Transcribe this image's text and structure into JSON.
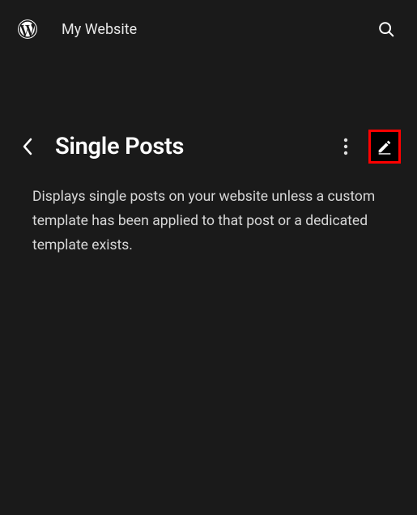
{
  "topbar": {
    "site_title": "My Website"
  },
  "header": {
    "page_title": "Single Posts"
  },
  "content": {
    "description": "Displays single posts on your website unless a custom template has been applied to that post or a dedicated template exists."
  },
  "highlight": {
    "color": "#ff0000"
  }
}
